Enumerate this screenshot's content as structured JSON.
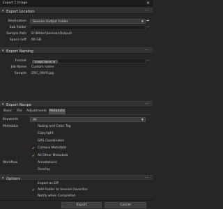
{
  "window": {
    "title": "Export 1 Image",
    "close_glyph": "✕"
  },
  "location": {
    "header": "Export Location",
    "destination_label": "Destination",
    "destination_value": "Session Output Folder",
    "subfolder_label": "Sub Folder",
    "subfolder_value": "",
    "sample_path_label": "Sample Path",
    "sample_path_value": "D:\\Bilder\\Session\\Output\\",
    "space_left_label": "Space Left",
    "space_left_value": "66 GB"
  },
  "naming": {
    "header": "Export Naming",
    "format_label": "Format",
    "format_token": "Image Name",
    "job_name_label": "Job Name",
    "job_name_value": "Custom name",
    "sample_label": "Sample",
    "sample_value": "DSC_0449.jpg"
  },
  "recipe": {
    "header": "Export Recipe",
    "tabs": [
      "Basic",
      "File",
      "Adjustments",
      "Metadata"
    ],
    "active_tab": "Metadata",
    "keywords_label": "Keywords",
    "keywords_value": "All",
    "metadata_label": "Metadata",
    "workflow_label": "Workflow",
    "metadata_items": [
      {
        "label": "Rating and Color Tag",
        "checked": false
      },
      {
        "label": "Copyright",
        "checked": false
      },
      {
        "label": "GPS Coordinates",
        "checked": false
      },
      {
        "label": "Camera Metadata",
        "checked": true
      },
      {
        "label": "All Other Metadata",
        "checked": true
      }
    ],
    "workflow_items": [
      {
        "label": "Annotations",
        "checked": false
      },
      {
        "label": "Overlay",
        "checked": false
      }
    ]
  },
  "options": {
    "header": "Options",
    "items": [
      {
        "label": "Export as EIP",
        "checked": false
      },
      {
        "label": "Add Folder to Session Favorites",
        "checked": true
      },
      {
        "label": "Notify when Completed",
        "checked": false
      }
    ]
  },
  "footer": {
    "export_label": "Export",
    "cancel_label": "Cancel"
  },
  "icons": {
    "section_chevron": "chevron-down-icon",
    "section_menu": "more-menu-icon",
    "folder_arrow": "arrow-right-icon",
    "check": "checkmark-icon"
  },
  "colors": {
    "background": "#262626",
    "section_header": "#323232",
    "accent_check": "#e0a030"
  }
}
